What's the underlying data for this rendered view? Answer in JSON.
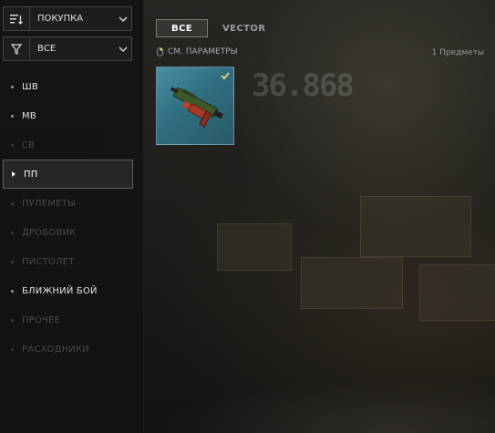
{
  "background": {
    "number_text": "36.868"
  },
  "sidebar": {
    "purchase_dropdown": {
      "label": "ПОКУПКА",
      "icon": "sort-lines-icon"
    },
    "filter_dropdown": {
      "label": "ВСЕ",
      "icon": "filter-funnel-icon"
    },
    "categories": [
      {
        "label": "ШВ",
        "state": "enabled"
      },
      {
        "label": "МВ",
        "state": "enabled"
      },
      {
        "label": "СВ",
        "state": "disabled"
      },
      {
        "label": "ПП",
        "state": "selected"
      },
      {
        "label": "ПУЛЕМЕТЫ",
        "state": "disabled"
      },
      {
        "label": "ДРОБОВИК",
        "state": "disabled"
      },
      {
        "label": "ПИСТОЛЕТ",
        "state": "disabled"
      },
      {
        "label": "БЛИЖНИЙ БОЙ",
        "state": "enabled"
      },
      {
        "label": "ПРОЧЕЕ",
        "state": "disabled"
      },
      {
        "label": "РАСХОДНИКИ",
        "state": "disabled"
      }
    ]
  },
  "main": {
    "tabs": [
      {
        "label": "ВСЕ",
        "selected": true
      },
      {
        "label": "VECTOR",
        "selected": false
      }
    ],
    "params_label": "СМ. ПАРАМЕТРЫ",
    "item_count": "1 Предметы",
    "items": [
      {
        "icon": "vector-smg-icon",
        "checked": true,
        "card_color": "#3f7f92"
      }
    ]
  },
  "colors": {
    "accent_check": "#e8d27a",
    "selected_tab_border": "#a0a0a0"
  }
}
